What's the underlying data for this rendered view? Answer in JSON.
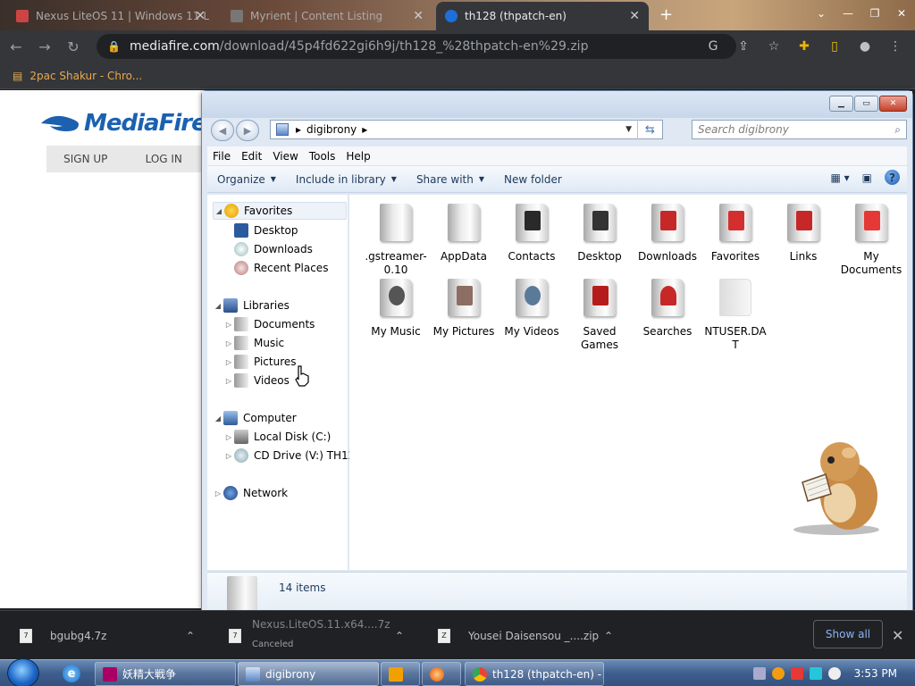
{
  "browser": {
    "tabs": [
      {
        "title": "Nexus LiteOS 11 | Windows 11 L"
      },
      {
        "title": "Myrient | Content Listing"
      },
      {
        "title": "th128 (thpatch-en)"
      }
    ],
    "url_domain": "mediafire.com",
    "url_path": "/download/45p4fd622gi6h9j/th128_%28thpatch-en%29.zip",
    "bookmark": "2pac Shakur - Chro..."
  },
  "webpage": {
    "logo": "MediaFire",
    "nav": [
      "SIGN UP",
      "LOG IN"
    ]
  },
  "explorer": {
    "breadcrumb": "digibrony",
    "search_placeholder": "Search digibrony",
    "menu": [
      "File",
      "Edit",
      "View",
      "Tools",
      "Help"
    ],
    "commands": [
      {
        "label": "Organize"
      },
      {
        "label": "Include in library"
      },
      {
        "label": "Share with"
      },
      {
        "label": "New folder"
      }
    ],
    "nav": {
      "favorites": "Favorites",
      "desktop": "Desktop",
      "downloads": "Downloads",
      "recent": "Recent Places",
      "libraries": "Libraries",
      "documents": "Documents",
      "music": "Music",
      "pictures": "Pictures",
      "videos": "Videos",
      "computer": "Computer",
      "local_disk": "Local Disk (C:)",
      "cd_drive": "CD Drive (V:) TH128",
      "network": "Network"
    },
    "files": [
      {
        "name": ".gstreamer-0.10",
        "icon": "folder-icon",
        "color": "#cccccc"
      },
      {
        "name": "AppData",
        "icon": "folder-icon",
        "color": "#dddddd"
      },
      {
        "name": "Contacts",
        "icon": "contacts-folder-icon",
        "color": "#2a2a2a"
      },
      {
        "name": "Desktop",
        "icon": "desktop-folder-icon",
        "color": "#333333"
      },
      {
        "name": "Downloads",
        "icon": "downloads-folder-icon",
        "color": "#c62828"
      },
      {
        "name": "Favorites",
        "icon": "favorites-folder-icon",
        "color": "#d32f2f"
      },
      {
        "name": "Links",
        "icon": "links-folder-icon",
        "color": "#c62828"
      },
      {
        "name": "My Documents",
        "icon": "documents-folder-icon",
        "color": "#e53935"
      },
      {
        "name": "My Music",
        "icon": "music-folder-icon",
        "color": "#555555"
      },
      {
        "name": "My Pictures",
        "icon": "pictures-folder-icon",
        "color": "#8d6e63"
      },
      {
        "name": "My Videos",
        "icon": "videos-folder-icon",
        "color": "#5a7a9a"
      },
      {
        "name": "Saved Games",
        "icon": "games-folder-icon",
        "color": "#b71c1c"
      },
      {
        "name": "Searches",
        "icon": "searches-folder-icon",
        "color": "#c62828"
      },
      {
        "name": "NTUSER.DAT",
        "icon": "file-icon",
        "color": "#eeeeee"
      }
    ],
    "item_count": "14 items"
  },
  "downloads": [
    {
      "name": "bgubg4.7z",
      "status": ""
    },
    {
      "name": "Nexus.LiteOS.11.x64....7z",
      "status": "Canceled"
    },
    {
      "name": "Yousei Daisensou _....zip",
      "status": ""
    }
  ],
  "downloads_show_all": "Show all",
  "taskbar": {
    "items": [
      "妖精大戦争",
      "digibrony",
      "",
      "",
      "th128 (thpatch-en) - ..."
    ],
    "time": "3:53 PM"
  }
}
